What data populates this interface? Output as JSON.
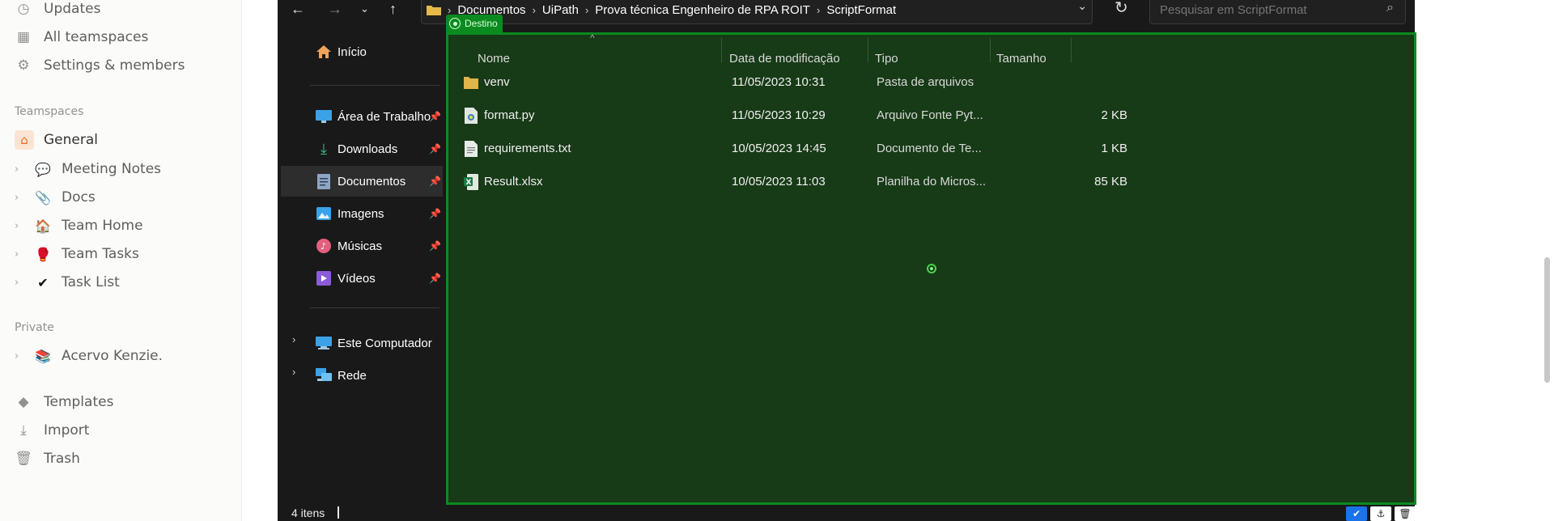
{
  "notion": {
    "top_items": [
      {
        "label": "Updates",
        "icon": "clock-icon"
      },
      {
        "label": "All teamspaces",
        "icon": "grid-icon"
      },
      {
        "label": "Settings & members",
        "icon": "gear-icon"
      }
    ],
    "teamspaces_heading": "Teamspaces",
    "teamspaces": [
      {
        "label": "General",
        "emoji": "🏠"
      },
      {
        "label": "Meeting Notes",
        "emoji": "💬"
      },
      {
        "label": "Docs",
        "emoji": "📎"
      },
      {
        "label": "Team Home",
        "emoji": "🏠"
      },
      {
        "label": "Team Tasks",
        "emoji": "🥊"
      },
      {
        "label": "Task List",
        "emoji": "✔"
      }
    ],
    "private_heading": "Private",
    "private": [
      {
        "label": "Acervo Kenzie.",
        "emoji": "📚"
      }
    ],
    "bottom_items": [
      {
        "label": "Templates",
        "icon": "shapes-icon"
      },
      {
        "label": "Import",
        "icon": "download-icon"
      },
      {
        "label": "Trash",
        "icon": "trash-icon"
      }
    ]
  },
  "explorer": {
    "breadcrumb": [
      "Documentos",
      "UiPath",
      "Prova técnica Engenheiro de RPA ROIT",
      "ScriptFormat"
    ],
    "search_placeholder": "Pesquisar em ScriptFormat",
    "nav": {
      "home": "Início",
      "quick_access": [
        {
          "label": "Área de Trabalho",
          "icon": "desktop-icon"
        },
        {
          "label": "Downloads",
          "icon": "downloads-icon"
        },
        {
          "label": "Documentos",
          "icon": "documents-icon",
          "selected": true
        },
        {
          "label": "Imagens",
          "icon": "images-icon"
        },
        {
          "label": "Músicas",
          "icon": "music-icon"
        },
        {
          "label": "Vídeos",
          "icon": "videos-icon"
        }
      ],
      "this_pc": "Este Computador",
      "network": "Rede"
    },
    "target_label": "Destino",
    "columns": {
      "name": "Nome",
      "modified": "Data de modificação",
      "type": "Tipo",
      "size": "Tamanho"
    },
    "files": [
      {
        "name": "venv",
        "modified": "11/05/2023 10:31",
        "type": "Pasta de arquivos",
        "size": "",
        "icon": "folder-icon"
      },
      {
        "name": "format.py",
        "modified": "11/05/2023 10:29",
        "type": "Arquivo Fonte Pyt...",
        "size": "2 KB",
        "icon": "python-file-icon"
      },
      {
        "name": "requirements.txt",
        "modified": "10/05/2023 14:45",
        "type": "Documento de Te...",
        "size": "1 KB",
        "icon": "text-file-icon"
      },
      {
        "name": "Result.xlsx",
        "modified": "10/05/2023 11:03",
        "type": "Planilha do Micros...",
        "size": "85 KB",
        "icon": "excel-file-icon"
      }
    ],
    "status": "4 itens"
  },
  "colors": {
    "target_border": "#0b8b1f",
    "target_fill": "#173a17",
    "explorer_bg": "#191919"
  }
}
